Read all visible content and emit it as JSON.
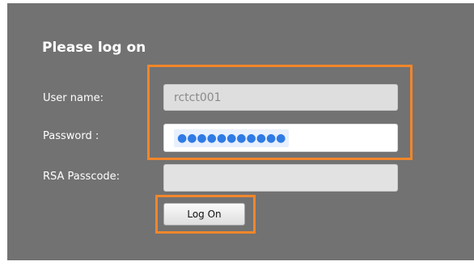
{
  "login": {
    "title": "Please log on",
    "username_label": "User name:",
    "username_value": "rctct001",
    "password_label": "Password :",
    "password_masked": "●●●●●●●●●●●",
    "rsa_label": "RSA Passcode:",
    "rsa_value": "",
    "logon_label": "Log On"
  },
  "colors": {
    "panel_background": "#727272",
    "highlight": "#f2862b",
    "text": "#ffffff"
  }
}
